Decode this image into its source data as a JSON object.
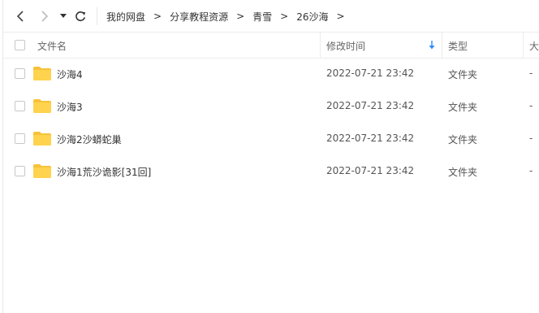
{
  "nav": {
    "back_icon": "chevron-left-icon",
    "forward_icon": "chevron-right-icon",
    "history_icon": "caret-down-icon",
    "refresh_icon": "refresh-icon"
  },
  "breadcrumb": {
    "items": [
      "我的网盘",
      "分享教程资源",
      "青雪",
      "26沙海"
    ],
    "separator": ">"
  },
  "table": {
    "headers": {
      "name": "文件名",
      "modified": "修改时间",
      "type": "类型",
      "size": "大"
    },
    "sort_icon": "sort-down-arrow-icon",
    "rows": [
      {
        "name": "沙海4",
        "modified": "2022-07-21 23:42",
        "type": "文件夹",
        "size": "-"
      },
      {
        "name": "沙海3",
        "modified": "2022-07-21 23:42",
        "type": "文件夹",
        "size": "-"
      },
      {
        "name": "沙海2沙蟒蛇巢",
        "modified": "2022-07-21 23:42",
        "type": "文件夹",
        "size": "-"
      },
      {
        "name": "沙海1荒沙诡影[31回]",
        "modified": "2022-07-21 23:42",
        "type": "文件夹",
        "size": "-"
      }
    ]
  },
  "colors": {
    "folder": "#FFD34E",
    "folder_dark": "#F5C23A",
    "sort_arrow": "#2F8CFF",
    "border": "#ececec"
  }
}
